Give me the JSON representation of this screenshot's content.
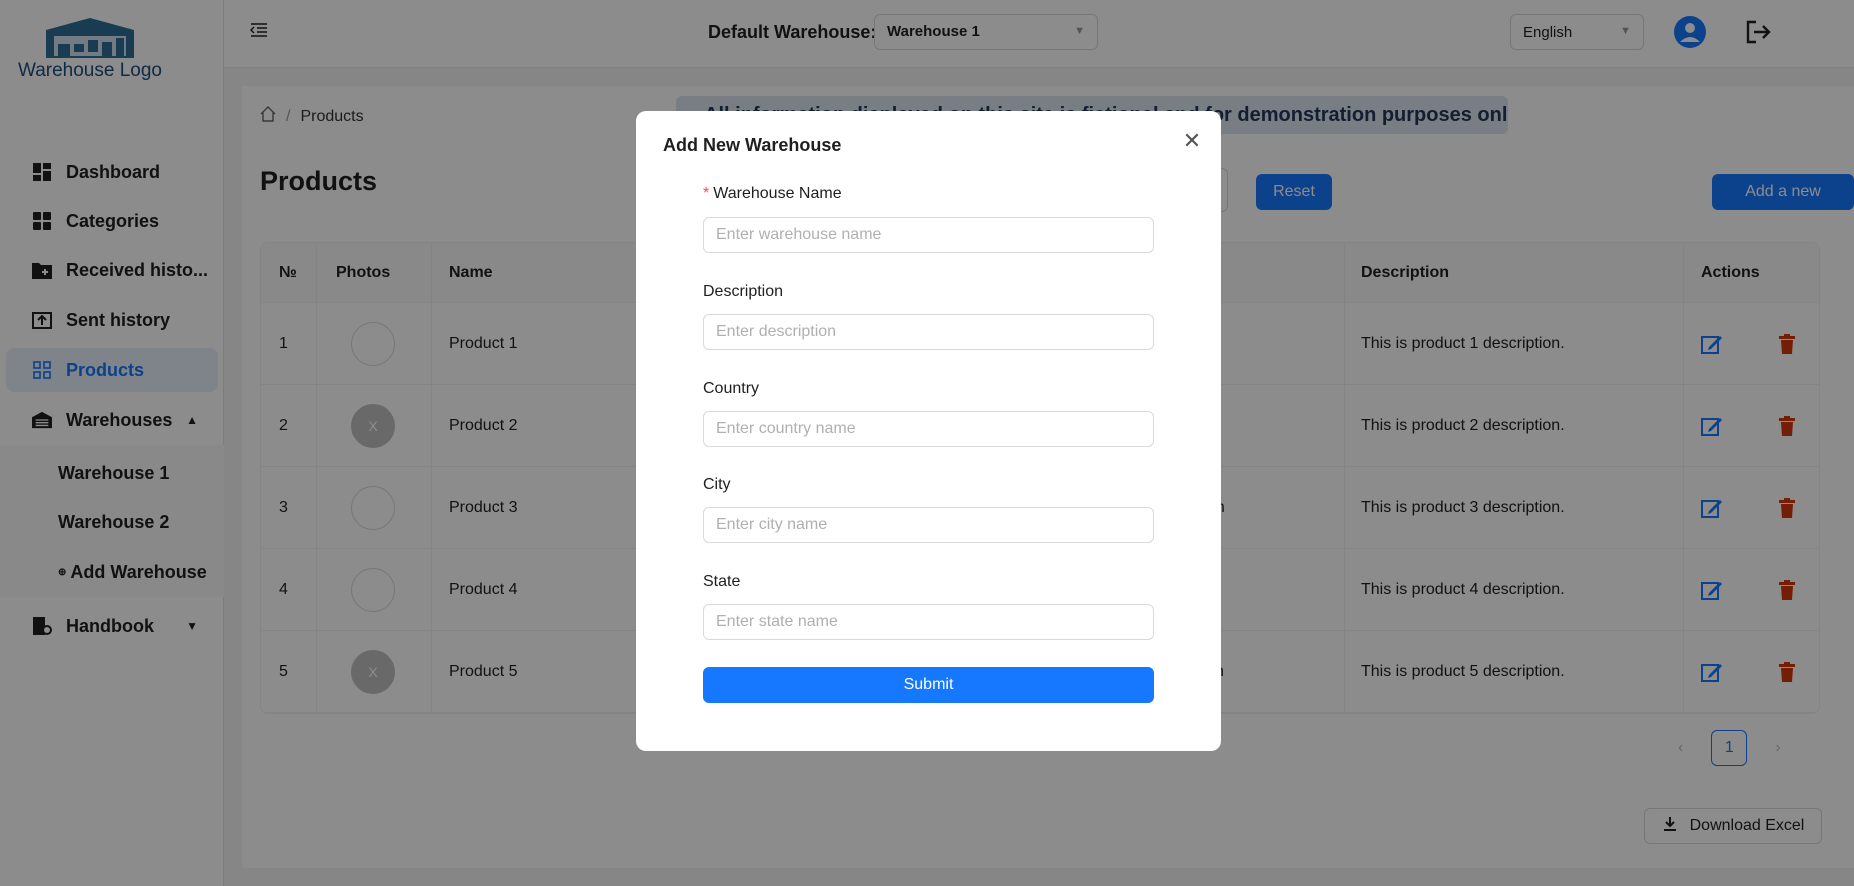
{
  "app": {
    "logo_text": "Warehouse Logo"
  },
  "header": {
    "default_warehouse_label": "Default Warehouse:",
    "default_warehouse_value": "Warehouse 1",
    "language": "English"
  },
  "sidebar": {
    "items": [
      {
        "label": "Dashboard"
      },
      {
        "label": "Categories"
      },
      {
        "label": "Received histo..."
      },
      {
        "label": "Sent history"
      },
      {
        "label": "Products"
      },
      {
        "label": "Warehouses"
      },
      {
        "label": "Handbook"
      }
    ],
    "warehouses": [
      {
        "label": "Warehouse 1"
      },
      {
        "label": "Warehouse 2"
      },
      {
        "label": "Add Warehouse"
      }
    ]
  },
  "breadcrumb": {
    "current": "Products"
  },
  "page": {
    "title": "Products",
    "banner": "All information displayed on this site is fictional and for demonstration purposes only.",
    "reset_label": "Reset",
    "add_label": "Add a new",
    "download_label": "Download Excel",
    "page_number": "1"
  },
  "table": {
    "headers": {
      "num": "№",
      "photos": "Photos",
      "name": "Name",
      "description": "Description",
      "actions": "Actions"
    },
    "rows": [
      {
        "num": "1",
        "photo": "",
        "name": "Product 1",
        "partial": "",
        "description": "This is product 1 description."
      },
      {
        "num": "2",
        "photo": "X",
        "name": "Product 2",
        "partial": "",
        "description": "This is product 2 description."
      },
      {
        "num": "3",
        "photo": "",
        "name": "Product 3",
        "partial": "on",
        "description": "This is product 3 description."
      },
      {
        "num": "4",
        "photo": "",
        "name": "Product 4",
        "partial": "",
        "description": "This is product 4 description."
      },
      {
        "num": "5",
        "photo": "X",
        "name": "Product 5",
        "partial": "vn",
        "description": "This is product 5 description."
      }
    ]
  },
  "modal": {
    "title": "Add New Warehouse",
    "fields": [
      {
        "label": "Warehouse Name",
        "required": "*",
        "placeholder": "Enter warehouse name",
        "value": ""
      },
      {
        "label": "Description",
        "placeholder": "Enter description",
        "value": ""
      },
      {
        "label": "Country",
        "placeholder": "Enter country name",
        "value": ""
      },
      {
        "label": "City",
        "placeholder": "Enter city name",
        "value": ""
      },
      {
        "label": "State",
        "placeholder": "Enter state name",
        "value": ""
      }
    ],
    "submit_label": "Submit"
  },
  "colors": {
    "primary": "#1677ff",
    "danger": "#d4380d",
    "overlay": "rgba(0,0,0,0.45)"
  }
}
